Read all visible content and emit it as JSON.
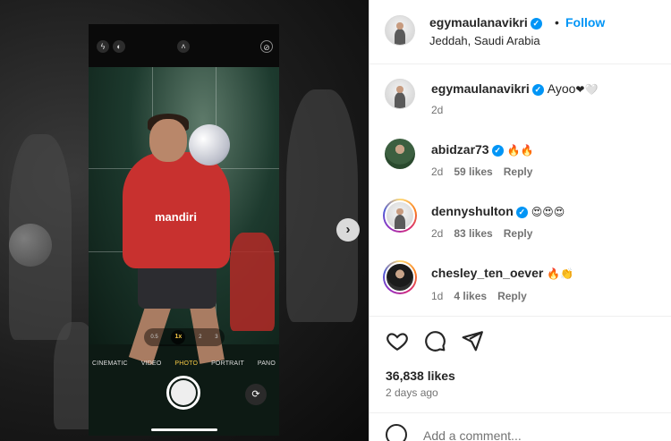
{
  "post": {
    "author": "egymaulanavikri",
    "follow_label": "Follow",
    "separator": "•",
    "location": "Jeddah, Saudi Arabia",
    "verified_icon": "✓"
  },
  "media": {
    "next_icon": "›",
    "camera": {
      "zoom_levels": [
        "0.5",
        "1x",
        "2",
        "3"
      ],
      "modes": [
        "CINEMATIC",
        "VIDEO",
        "PHOTO",
        "PORTRAIT",
        "PANO"
      ],
      "active_mode": "PHOTO",
      "brand_text": "mandiri",
      "flip_icon": "⟳"
    }
  },
  "comments": [
    {
      "username": "egymaulanavikri",
      "text": "Ayoo",
      "emoji": "❤🤍",
      "age": "2d",
      "likes": "",
      "reply": ""
    },
    {
      "username": "abidzar73",
      "text": "",
      "emoji": "🔥🔥",
      "age": "2d",
      "likes": "59 likes",
      "reply": "Reply"
    },
    {
      "username": "dennyshulton",
      "text": "",
      "emoji": "😍😍😍",
      "age": "2d",
      "likes": "83 likes",
      "reply": "Reply"
    },
    {
      "username": "chesley_ten_oever",
      "text": "",
      "emoji": "🔥👏",
      "age": "1d",
      "likes": "4 likes",
      "reply": "Reply"
    }
  ],
  "stats": {
    "likes": "36,838 likes",
    "posted": "2 days ago"
  },
  "composer": {
    "placeholder": "Add a comment..."
  },
  "colors": {
    "accent": "#0095f6",
    "text": "#262626",
    "muted": "#737373",
    "verified": "#0095f6"
  }
}
